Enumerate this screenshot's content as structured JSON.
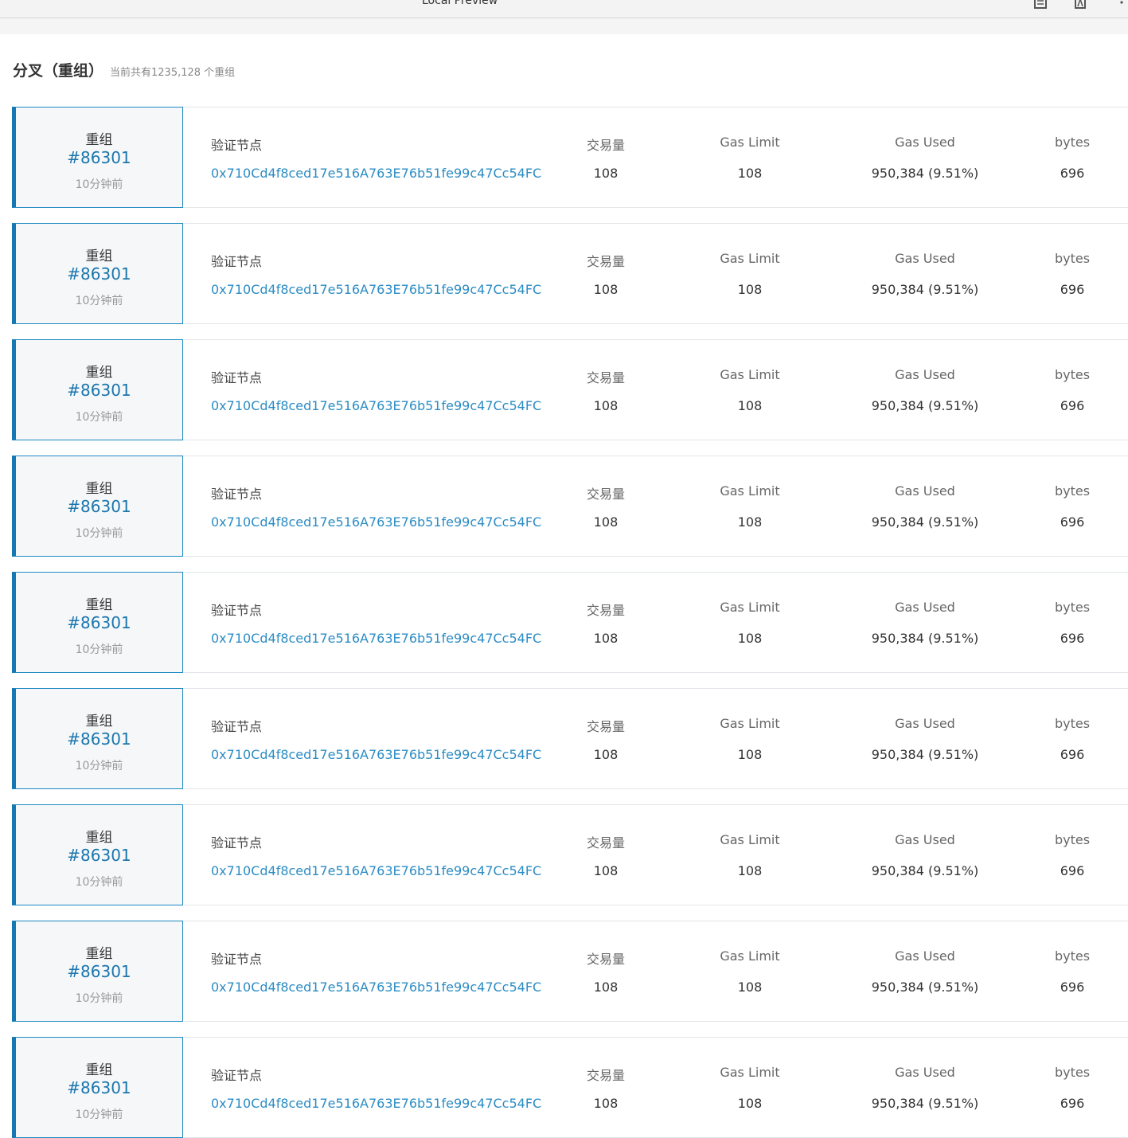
{
  "window": {
    "title": "Local Preview",
    "icons": [
      "document-icon",
      "pdf-icon",
      "more-icon"
    ]
  },
  "header": {
    "title": "分叉（重组）",
    "subtitle": "当前共有1235,128 个重组"
  },
  "columns": {
    "validator": "验证节点",
    "tx_count": "交易量",
    "gas_limit": "Gas Limit",
    "gas_used": "Gas Used",
    "bytes": "bytes"
  },
  "forks": [
    {
      "label": "重组",
      "number": "#86301",
      "time": "10分钟前",
      "validator": "0x710Cd4f8ced17e516A763E76b51fe99c47Cc54FC",
      "tx_count": "108",
      "gas_limit": "108",
      "gas_used": "950,384  (9.51%)",
      "bytes": "696"
    },
    {
      "label": "重组",
      "number": "#86301",
      "time": "10分钟前",
      "validator": "0x710Cd4f8ced17e516A763E76b51fe99c47Cc54FC",
      "tx_count": "108",
      "gas_limit": "108",
      "gas_used": "950,384  (9.51%)",
      "bytes": "696"
    },
    {
      "label": "重组",
      "number": "#86301",
      "time": "10分钟前",
      "validator": "0x710Cd4f8ced17e516A763E76b51fe99c47Cc54FC",
      "tx_count": "108",
      "gas_limit": "108",
      "gas_used": "950,384  (9.51%)",
      "bytes": "696"
    },
    {
      "label": "重组",
      "number": "#86301",
      "time": "10分钟前",
      "validator": "0x710Cd4f8ced17e516A763E76b51fe99c47Cc54FC",
      "tx_count": "108",
      "gas_limit": "108",
      "gas_used": "950,384  (9.51%)",
      "bytes": "696"
    },
    {
      "label": "重组",
      "number": "#86301",
      "time": "10分钟前",
      "validator": "0x710Cd4f8ced17e516A763E76b51fe99c47Cc54FC",
      "tx_count": "108",
      "gas_limit": "108",
      "gas_used": "950,384  (9.51%)",
      "bytes": "696"
    },
    {
      "label": "重组",
      "number": "#86301",
      "time": "10分钟前",
      "validator": "0x710Cd4f8ced17e516A763E76b51fe99c47Cc54FC",
      "tx_count": "108",
      "gas_limit": "108",
      "gas_used": "950,384  (9.51%)",
      "bytes": "696"
    },
    {
      "label": "重组",
      "number": "#86301",
      "time": "10分钟前",
      "validator": "0x710Cd4f8ced17e516A763E76b51fe99c47Cc54FC",
      "tx_count": "108",
      "gas_limit": "108",
      "gas_used": "950,384  (9.51%)",
      "bytes": "696"
    },
    {
      "label": "重组",
      "number": "#86301",
      "time": "10分钟前",
      "validator": "0x710Cd4f8ced17e516A763E76b51fe99c47Cc54FC",
      "tx_count": "108",
      "gas_limit": "108",
      "gas_used": "950,384  (9.51%)",
      "bytes": "696"
    },
    {
      "label": "重组",
      "number": "#86301",
      "time": "10分钟前",
      "validator": "0x710Cd4f8ced17e516A763E76b51fe99c47Cc54FC",
      "tx_count": "108",
      "gas_limit": "108",
      "gas_used": "950,384  (9.51%)",
      "bytes": "696"
    }
  ]
}
